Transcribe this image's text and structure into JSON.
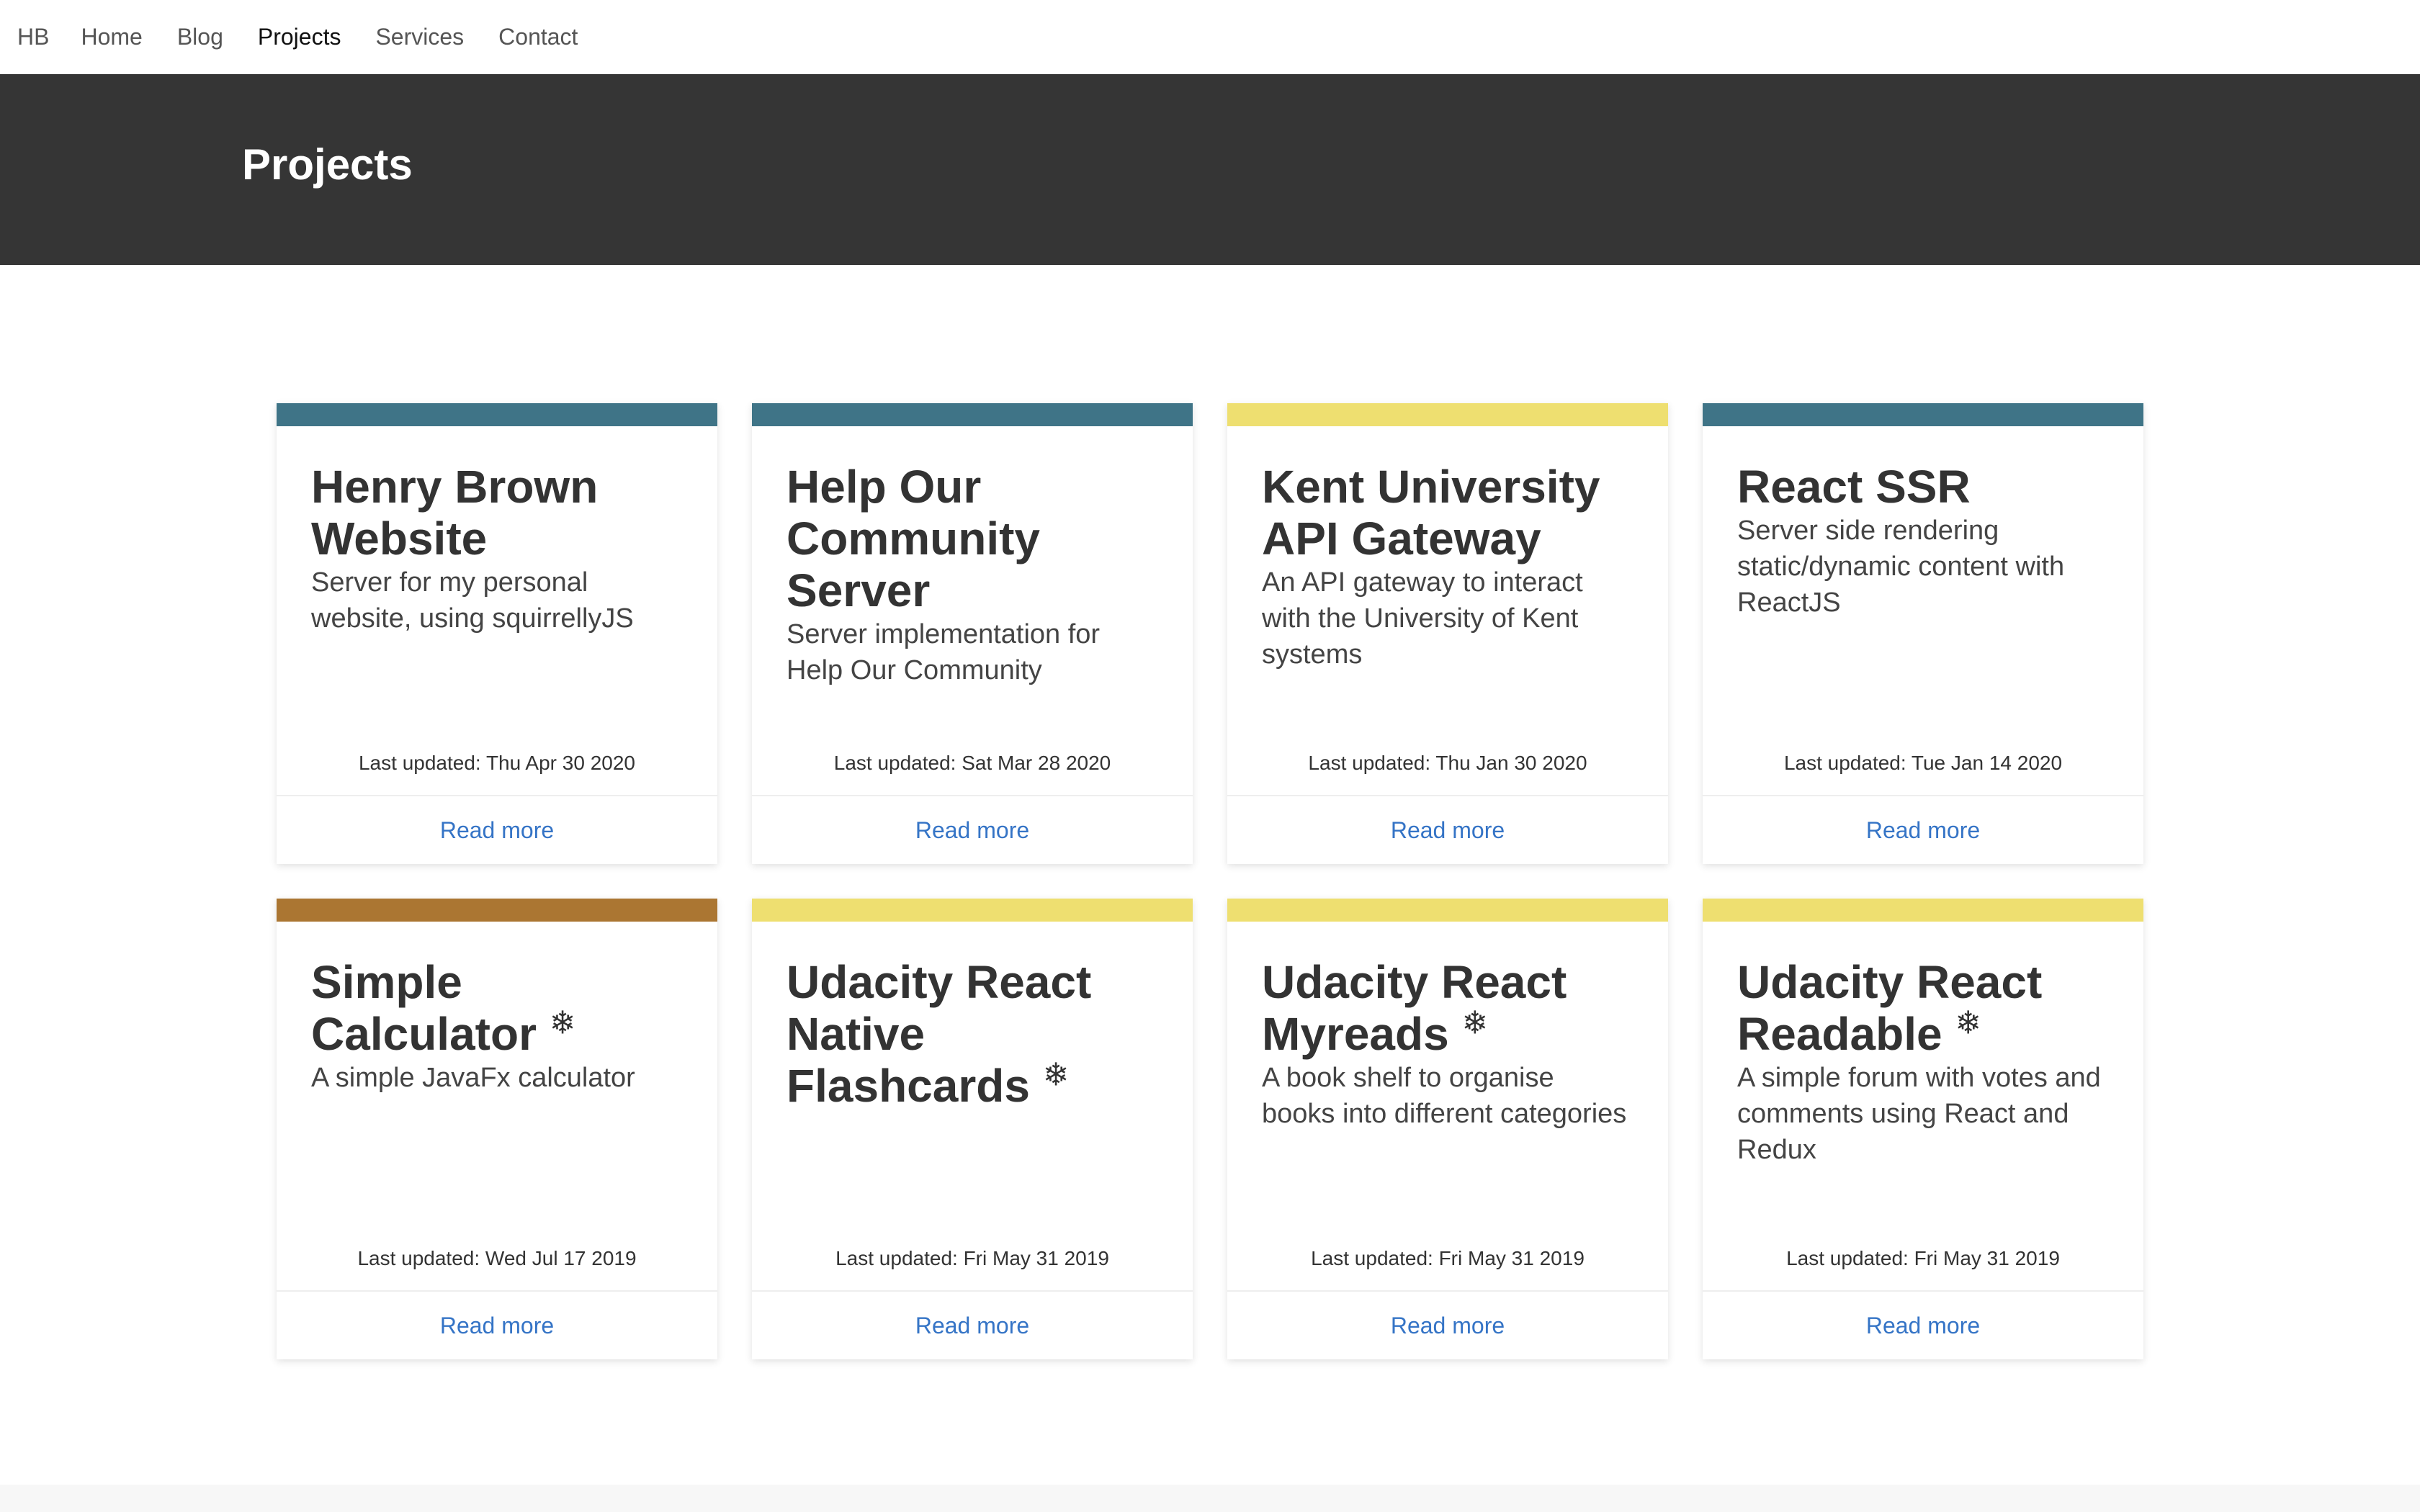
{
  "nav": {
    "brand": "HB",
    "items": [
      {
        "label": "Home",
        "active": false
      },
      {
        "label": "Blog",
        "active": false
      },
      {
        "label": "Projects",
        "active": true
      },
      {
        "label": "Services",
        "active": false
      },
      {
        "label": "Contact",
        "active": false
      }
    ]
  },
  "hero": {
    "title": "Projects"
  },
  "colors": {
    "teal": "#3f7487",
    "yellow": "#eedf70",
    "brown": "#ab7632",
    "link": "#3574c6",
    "hero_bg": "#353535"
  },
  "projects": [
    {
      "title": "Henry Brown Website",
      "archived": false,
      "description": "Server for my personal website, using squirrellyJS",
      "updated": "Last updated: Thu Apr 30 2020",
      "link_label": "Read more",
      "accent": "#3f7487"
    },
    {
      "title": "Help Our Community Server",
      "archived": false,
      "description": "Server implementation for Help Our Community",
      "updated": "Last updated: Sat Mar 28 2020",
      "link_label": "Read more",
      "accent": "#3f7487"
    },
    {
      "title": "Kent University API Gateway",
      "archived": false,
      "description": "An API gateway to interact with the University of Kent systems",
      "updated": "Last updated: Thu Jan 30 2020",
      "link_label": "Read more",
      "accent": "#eedf70"
    },
    {
      "title": "React SSR",
      "archived": false,
      "description": "Server side rendering static/dynamic content with ReactJS",
      "updated": "Last updated: Tue Jan 14 2020",
      "link_label": "Read more",
      "accent": "#3f7487"
    },
    {
      "title": "Simple Calculator",
      "archived": true,
      "description": "A simple JavaFx calculator",
      "updated": "Last updated: Wed Jul 17 2019",
      "link_label": "Read more",
      "accent": "#ab7632"
    },
    {
      "title": "Udacity React Native Flashcards",
      "archived": true,
      "description": "",
      "updated": "Last updated: Fri May 31 2019",
      "link_label": "Read more",
      "accent": "#eedf70"
    },
    {
      "title": "Udacity React Myreads",
      "archived": true,
      "description": "A book shelf to organise books into different categories",
      "updated": "Last updated: Fri May 31 2019",
      "link_label": "Read more",
      "accent": "#eedf70"
    },
    {
      "title": "Udacity React Readable",
      "archived": true,
      "description": "A simple forum with votes and comments using React and Redux",
      "updated": "Last updated: Fri May 31 2019",
      "link_label": "Read more",
      "accent": "#eedf70"
    }
  ],
  "icons": {
    "archived": "❄"
  }
}
